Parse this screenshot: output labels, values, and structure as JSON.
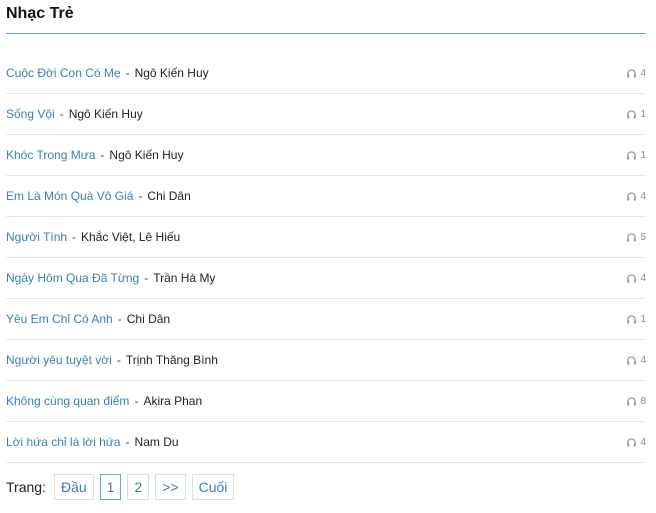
{
  "header": {
    "title": "Nhạc Trẻ"
  },
  "songs": [
    {
      "title": "Cuộc Đời Con Có Mẹ",
      "artist": "Ngô Kiến Huy",
      "plays": "4"
    },
    {
      "title": "Sống Vội",
      "artist": "Ngô Kiến Huy",
      "plays": "1"
    },
    {
      "title": "Khóc Trong Mưa",
      "artist": "Ngô Kiến Huy",
      "plays": "1"
    },
    {
      "title": "Em Là Món Quà Vô Giá",
      "artist": "Chi Dân",
      "plays": "4"
    },
    {
      "title": "Người Tình",
      "artist": "Khắc Việt, Lê Hiếu",
      "plays": "5"
    },
    {
      "title": "Ngày Hôm Qua Đã Từng",
      "artist": "Trần Hà My",
      "plays": "4"
    },
    {
      "title": "Yêu Em Chỉ Có Anh",
      "artist": "Chi Dân",
      "plays": "1"
    },
    {
      "title": "Người yêu tuyệt vời",
      "artist": "Trịnh Thăng Bình",
      "plays": "4"
    },
    {
      "title": "Không cùng quan điểm",
      "artist": "Akira Phan",
      "plays": "8"
    },
    {
      "title": "Lời hứa chỉ là lời hứa",
      "artist": "Nam Du",
      "plays": "4"
    }
  ],
  "separator": "-",
  "play_icon": "headphones-icon",
  "pagination": {
    "label": "Trang:",
    "first": "Đầu",
    "pages": [
      "1",
      "2"
    ],
    "current": "1",
    "next": ">>",
    "last": "Cuối"
  },
  "colors": {
    "link": "#3a7fb6",
    "accent_line": "#5ab0c8",
    "meta": "#8a8a8a"
  }
}
